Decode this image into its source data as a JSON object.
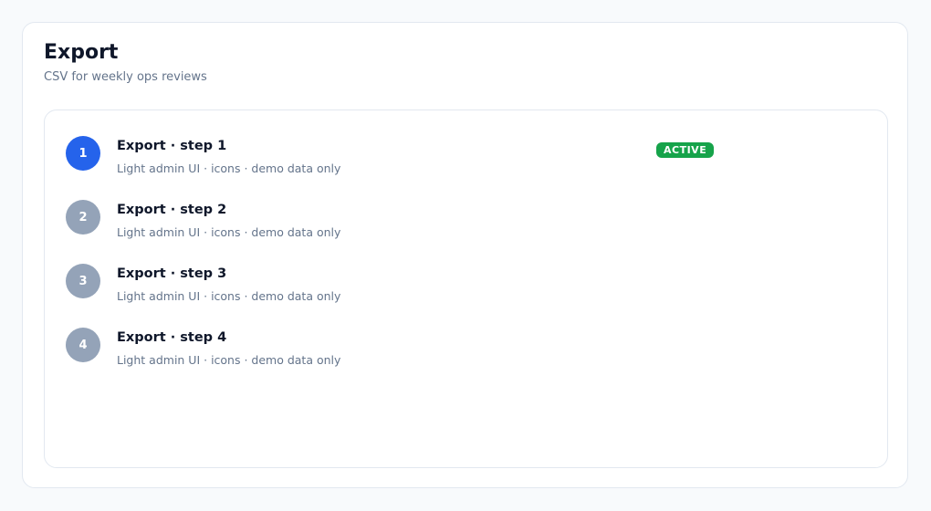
{
  "header": {
    "title": "Export",
    "subtitle": "CSV for weekly ops reviews"
  },
  "steps": [
    {
      "number": "1",
      "title": "Export · step 1",
      "description": "Light admin UI · icons · demo data only",
      "state": "active",
      "badge": "ACTIVE"
    },
    {
      "number": "2",
      "title": "Export · step 2",
      "description": "Light admin UI · icons · demo data only",
      "state": "inactive"
    },
    {
      "number": "3",
      "title": "Export · step 3",
      "description": "Light admin UI · icons · demo data only",
      "state": "inactive"
    },
    {
      "number": "4",
      "title": "Export · step 4",
      "description": "Light admin UI · icons · demo data only",
      "state": "inactive"
    }
  ],
  "colors": {
    "active_step": "#2563eb",
    "inactive_step": "#94a3b8",
    "badge_active": "#16a34a"
  }
}
